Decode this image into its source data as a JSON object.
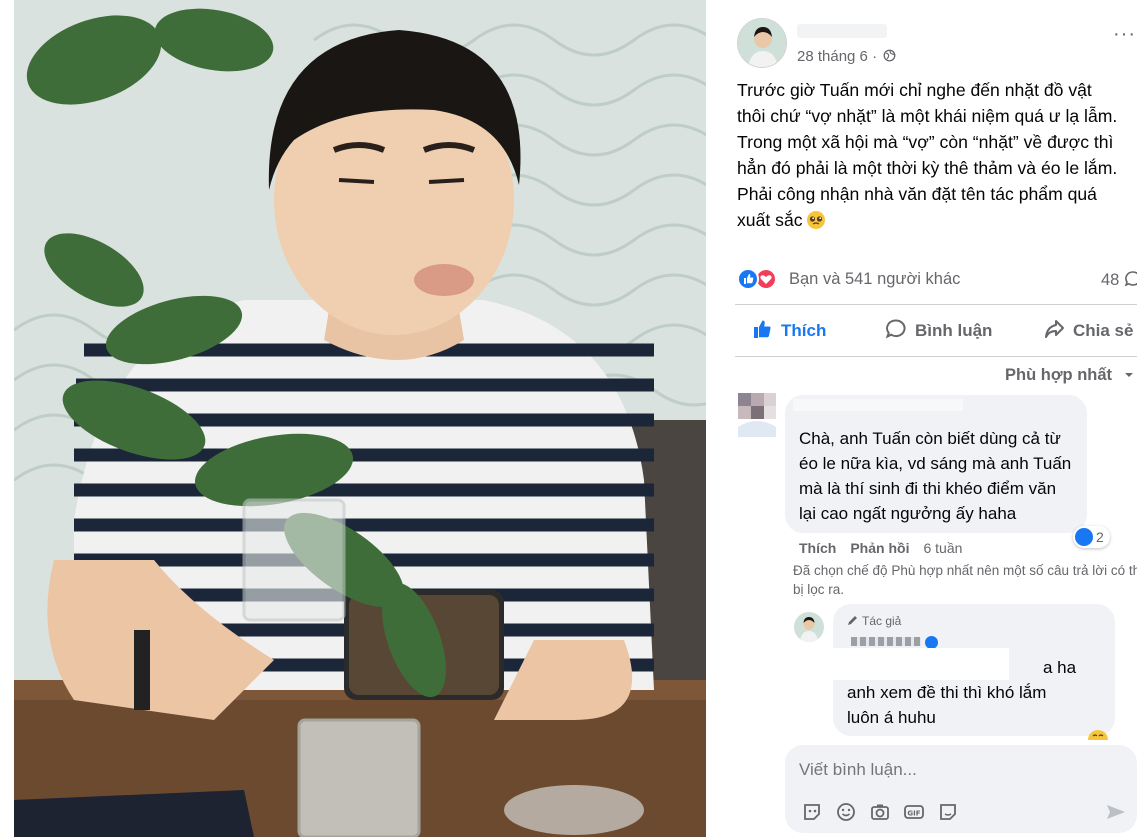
{
  "post": {
    "date": "28 tháng 6 ·",
    "more": "···",
    "text_lines": [
      "Trước giờ Tuấn mới chỉ nghe đến nhặt đồ vật",
      "thôi chứ “vợ nhặt” là một khái niệm quá ư lạ lẫm.",
      "Trong một xã hội mà “vợ” còn “nhặt” về được thì",
      "hẳn đó phải là một thời kỳ thê thảm và éo le lắm.",
      "Phải công nhận nhà văn đặt tên tác phẩm quá",
      "xuất sắc"
    ],
    "reaction_summary": "Bạn và 541 người khác",
    "comment_count": "48",
    "actions": {
      "like": "Thích",
      "comment": "Bình luận",
      "share": "Chia sẻ"
    },
    "sort_label": "Phù hợp nhất"
  },
  "comments": [
    {
      "lines": [
        "Chà, anh Tuấn còn biết dùng cả từ",
        "éo le nữa kìa, vd sáng mà anh Tuấn",
        "mà là thí sinh đi thi khéo điểm văn",
        "lại cao ngất ngưởng ấy haha"
      ],
      "like_label": "Thích",
      "reply_label": "Phản hồi",
      "time": "6 tuần",
      "reaction_count": "2"
    }
  ],
  "filter_note": "Đã chọn chế độ Phù hợp nhất nên một số câu trả lời có thể bị lọc ra.",
  "reply": {
    "author_tag": "Tác giả",
    "lines": [
      "a ha",
      "anh xem đề thi thì khó lắm",
      "luôn á huhu"
    ]
  },
  "composer": {
    "placeholder": "Viết bình luận..."
  },
  "colors": {
    "brand": "#1877f2",
    "love": "#f33e58",
    "bubble": "#f0f2f5",
    "muted": "#65676b"
  }
}
